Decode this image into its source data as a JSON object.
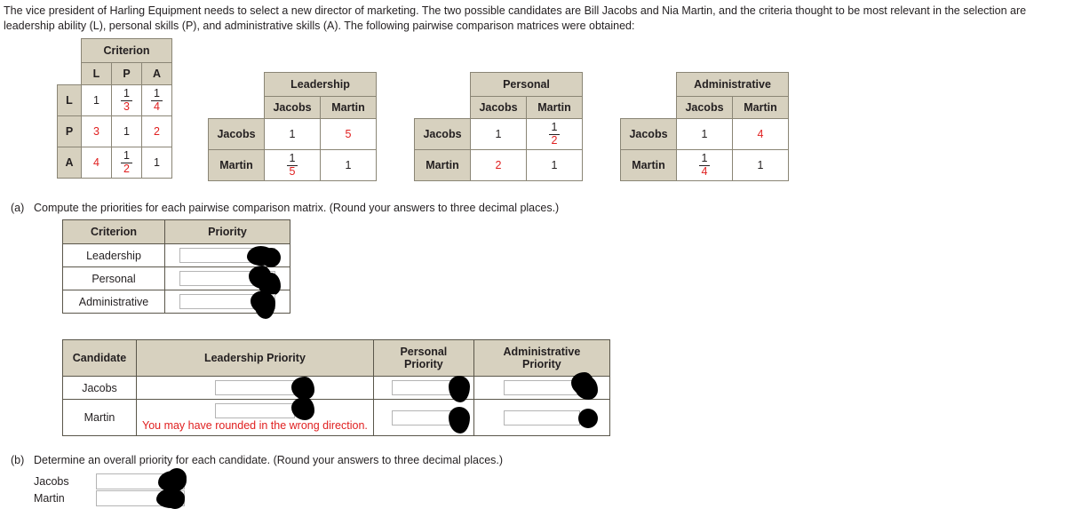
{
  "intro": {
    "text": "The vice president of Harling Equipment needs to select a new director of marketing. The two possible candidates are Bill Jacobs and Nia Martin, and the criteria thought to be most relevant in the selection are leadership ability (L), personal skills (P), and administrative skills (A). The following pairwise comparison matrices were obtained:"
  },
  "criterion_matrix": {
    "title": "Criterion",
    "col_headers": [
      "L",
      "P",
      "A"
    ],
    "row_headers": [
      "L",
      "P",
      "A"
    ],
    "rows": [
      [
        {
          "v": "1",
          "red": false
        },
        {
          "n": "1",
          "d": "3"
        },
        {
          "n": "1",
          "d": "4"
        }
      ],
      [
        {
          "v": "3",
          "red": true
        },
        {
          "v": "1",
          "red": false
        },
        {
          "v": "2",
          "red": true
        }
      ],
      [
        {
          "v": "4",
          "red": true
        },
        {
          "n": "1",
          "d": "2"
        },
        {
          "v": "1",
          "red": false
        }
      ]
    ]
  },
  "leadership_matrix": {
    "title": "Leadership",
    "col_headers": [
      "Jacobs",
      "Martin"
    ],
    "row_headers": [
      "Jacobs",
      "Martin"
    ],
    "rows": [
      [
        {
          "v": "1",
          "red": false
        },
        {
          "v": "5",
          "red": true
        }
      ],
      [
        {
          "n": "1",
          "d": "5"
        },
        {
          "v": "1",
          "red": false
        }
      ]
    ]
  },
  "personal_matrix": {
    "title": "Personal",
    "col_headers": [
      "Jacobs",
      "Martin"
    ],
    "row_headers": [
      "Jacobs",
      "Martin"
    ],
    "rows": [
      [
        {
          "v": "1",
          "red": false
        },
        {
          "n": "1",
          "d": "2"
        }
      ],
      [
        {
          "v": "2",
          "red": true
        },
        {
          "v": "1",
          "red": false
        }
      ]
    ]
  },
  "administrative_matrix": {
    "title": "Administrative",
    "col_headers": [
      "Jacobs",
      "Martin"
    ],
    "row_headers": [
      "Jacobs",
      "Martin"
    ],
    "rows": [
      [
        {
          "v": "1",
          "red": false
        },
        {
          "v": "4",
          "red": true
        }
      ],
      [
        {
          "n": "1",
          "d": "4"
        },
        {
          "v": "1",
          "red": false
        }
      ]
    ]
  },
  "part_a": {
    "label": "(a)",
    "text": "Compute the priorities for each pairwise comparison matrix. (Round your answers to three decimal places.)",
    "priority_table": {
      "headers": [
        "Criterion",
        "Priority"
      ],
      "rows": [
        {
          "criterion": "Leadership",
          "value": ""
        },
        {
          "criterion": "Personal",
          "value": ""
        },
        {
          "criterion": "Administrative",
          "value": ""
        }
      ]
    },
    "candidate_table": {
      "headers": [
        "Candidate",
        "Leadership Priority",
        "Personal Priority",
        "Administrative Priority"
      ],
      "rows": [
        {
          "candidate": "Jacobs",
          "leadership": "",
          "leadership_error": "",
          "personal": "",
          "administrative": ""
        },
        {
          "candidate": "Martin",
          "leadership": "",
          "leadership_error": "You may have rounded in the wrong direction.",
          "personal": "",
          "administrative": ""
        }
      ]
    }
  },
  "part_b": {
    "label": "(b)",
    "text": "Determine an overall priority for each candidate. (Round your answers to three decimal places.)",
    "rows": [
      {
        "label": "Jacobs",
        "value": ""
      },
      {
        "label": "Martin",
        "value": ""
      }
    ]
  },
  "colors": {
    "header_bg": "#d7d1bf",
    "border": "#5a564a",
    "red": "#e02020",
    "text": "#231f20",
    "redaction": "#000000"
  }
}
